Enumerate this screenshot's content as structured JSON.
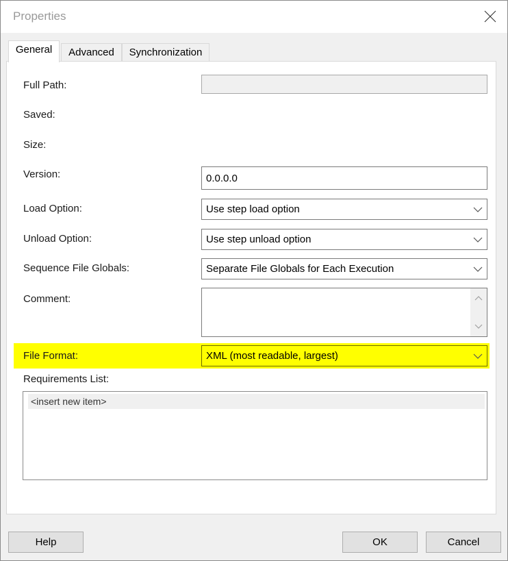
{
  "window": {
    "title": "Properties",
    "close_icon": "close-icon"
  },
  "tabs": [
    {
      "label": "General",
      "active": true
    },
    {
      "label": "Advanced",
      "active": false
    },
    {
      "label": "Synchronization",
      "active": false
    }
  ],
  "general": {
    "full_path": {
      "label": "Full Path:",
      "value": ""
    },
    "saved": {
      "label": "Saved:",
      "value": ""
    },
    "size": {
      "label": "Size:",
      "value": ""
    },
    "version": {
      "label": "Version:",
      "value": "0.0.0.0"
    },
    "load_option": {
      "label": "Load Option:",
      "value": "Use step load option"
    },
    "unload_option": {
      "label": "Unload Option:",
      "value": "Use step unload option"
    },
    "sequence_file_globals": {
      "label": "Sequence File Globals:",
      "value": "Separate File Globals for Each Execution"
    },
    "comment": {
      "label": "Comment:",
      "value": ""
    },
    "file_format": {
      "label": "File Format:",
      "value": "XML (most readable, largest)",
      "highlight_color": "#ffff00"
    },
    "requirements": {
      "label": "Requirements List:",
      "items": [
        "<insert new item>"
      ]
    }
  },
  "buttons": {
    "help": "Help",
    "ok": "OK",
    "cancel": "Cancel"
  }
}
